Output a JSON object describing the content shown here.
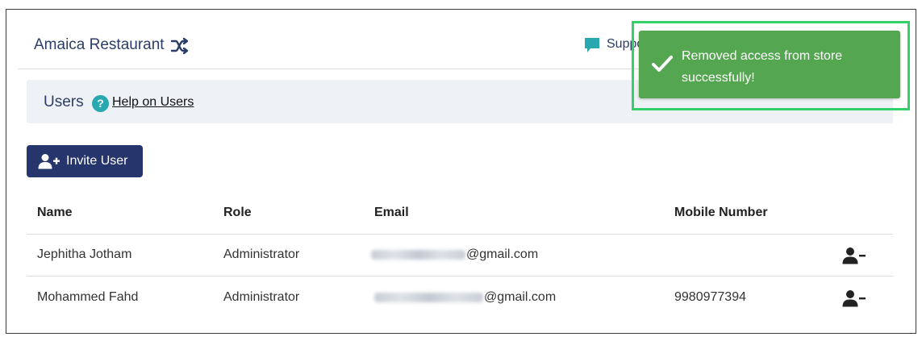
{
  "header": {
    "store_name": "Amaica Restaurant",
    "support_label": "Support",
    "icons": [
      "shuffle-icon",
      "chat-bubble-icon"
    ]
  },
  "users_section": {
    "title": "Users",
    "help_icon_glyph": "?",
    "help_link": "Help on Users"
  },
  "actions": {
    "invite_label": "Invite User"
  },
  "table": {
    "columns": [
      "Name",
      "Role",
      "Email",
      "Mobile Number"
    ],
    "rows": [
      {
        "name": "Jephitha Jotham",
        "role": "Administrator",
        "email_domain": "@gmail.com",
        "mobile": ""
      },
      {
        "name": "Mohammed Fahd",
        "role": "Administrator",
        "email_domain": "@gmail.com",
        "mobile": "9980977394"
      }
    ]
  },
  "toast": {
    "message": "Removed access from store successfully!",
    "type": "success",
    "color": "#55a650",
    "highlight_color": "#34d06a"
  },
  "colors": {
    "primary": "#26356b",
    "heading_text": "#2c3e66",
    "help_icon": "#2aa8b0",
    "panel_bg": "#eef1f5"
  }
}
